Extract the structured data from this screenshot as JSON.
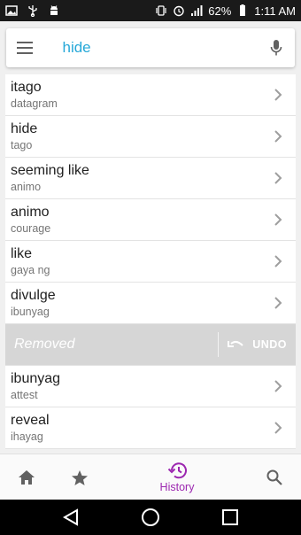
{
  "status_bar": {
    "battery": "62%",
    "time": "1:11 AM"
  },
  "search": {
    "query": "hide",
    "placeholder": ""
  },
  "list_top": [
    {
      "word": "itago",
      "translation": "datagram"
    },
    {
      "word": "hide",
      "translation": "tago"
    },
    {
      "word": "seeming like",
      "translation": "animo"
    },
    {
      "word": "animo",
      "translation": "courage"
    },
    {
      "word": "like",
      "translation": "gaya ng"
    },
    {
      "word": "divulge",
      "translation": "ibunyag"
    }
  ],
  "removed": {
    "text": "Removed",
    "undo_label": "UNDO"
  },
  "list_bottom": [
    {
      "word": "ibunyag",
      "translation": "attest"
    },
    {
      "word": "reveal",
      "translation": "ihayag"
    }
  ],
  "bottom_nav": {
    "history_label": "History"
  },
  "colors": {
    "accent": "#9c27b0",
    "query": "#26a8d8",
    "removed_bg": "#d6d6d6"
  }
}
